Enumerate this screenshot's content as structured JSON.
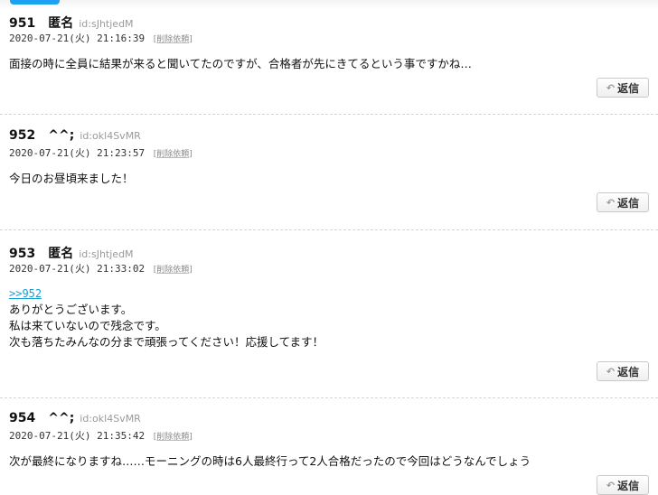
{
  "posts": [
    {
      "number": "951",
      "name": "匿名",
      "id": "id:sJhtjedM",
      "datetime": "2020-07-21(火) 21:16:39",
      "report_label": "削除依頼",
      "anchor": "",
      "lines": [
        "面接の時に全員に結果が来ると聞いてたのですが、合格者が先にきてるという事ですかね…"
      ],
      "reply_label": "返信"
    },
    {
      "number": "952",
      "name": "^^;",
      "id": "id:okl4SvMR",
      "datetime": "2020-07-21(火) 21:23:57",
      "report_label": "削除依頼",
      "anchor": "",
      "lines": [
        "今日のお昼頃来ました！"
      ],
      "reply_label": "返信"
    },
    {
      "number": "953",
      "name": "匿名",
      "id": "id:sJhtjedM",
      "datetime": "2020-07-21(火) 21:33:02",
      "report_label": "削除依頼",
      "anchor": ">>952",
      "lines": [
        "ありがとうございます。",
        "私は来ていないので残念です。",
        "次も落ちたみんなの分まで頑張ってください！応援してます！"
      ],
      "reply_label": "返信"
    },
    {
      "number": "954",
      "name": "^^;",
      "id": "id:okl4SvMR",
      "datetime": "2020-07-21(火) 21:35:42",
      "report_label": "削除依頼",
      "anchor": "",
      "lines": [
        "次が最終になりますね……モーニングの時は6人最終行って2人合格だったので今回はどうなんでしょう"
      ],
      "reply_label": "返信"
    }
  ],
  "icons": {
    "reply": "reply-arrow-icon"
  }
}
